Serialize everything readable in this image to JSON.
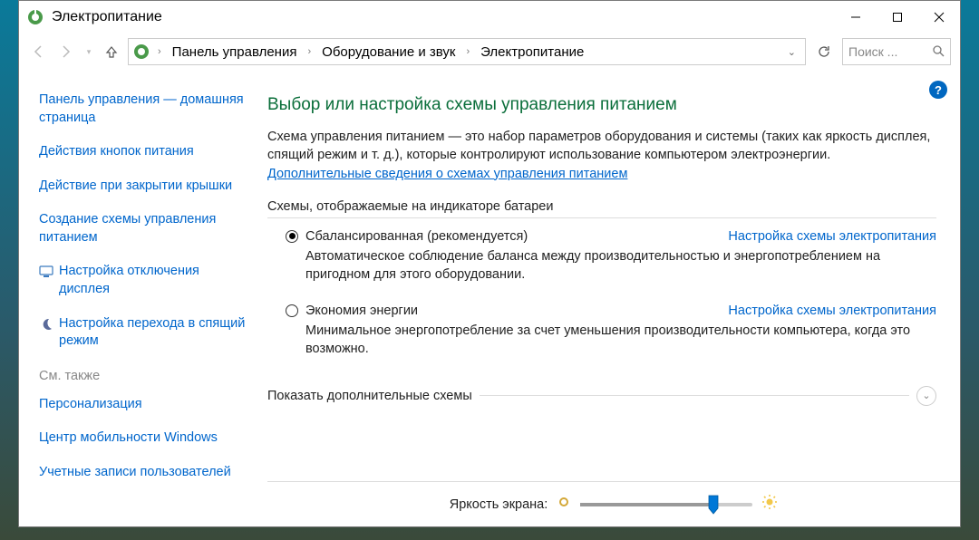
{
  "window": {
    "title": "Электропитание"
  },
  "breadcrumb": {
    "items": [
      "Панель управления",
      "Оборудование и звук",
      "Электропитание"
    ]
  },
  "search": {
    "placeholder": "Поиск ..."
  },
  "sidebar": {
    "home": "Панель управления — домашняя страница",
    "links": [
      "Действия кнопок питания",
      "Действие при закрытии крышки",
      "Создание схемы управления питанием",
      "Настройка отключения дисплея",
      "Настройка перехода в спящий режим"
    ],
    "see_also_hdr": "См. также",
    "see_also": [
      "Персонализация",
      "Центр мобильности Windows",
      "Учетные записи пользователей"
    ]
  },
  "content": {
    "heading": "Выбор или настройка схемы управления питанием",
    "description": "Схема управления питанием — это набор параметров оборудования и системы (таких как яркость дисплея, спящий режим и т. д.), которые контролируют использование компьютером электроэнергии.",
    "more_info": "Дополнительные сведения о схемах управления питанием",
    "section_hdr": "Схемы, отображаемые на индикаторе батареи",
    "plans": [
      {
        "name": "Сбалансированная (рекомендуется)",
        "selected": true,
        "desc": "Автоматическое соблюдение баланса между производительностью и энергопотреблением на пригодном для этого оборудовании.",
        "config": "Настройка схемы электропитания"
      },
      {
        "name": "Экономия энергии",
        "selected": false,
        "desc": "Минимальное энергопотребление за счет уменьшения производительности компьютера, когда это возможно.",
        "config": "Настройка схемы электропитания"
      }
    ],
    "expand_label": "Показать дополнительные схемы",
    "brightness_label": "Яркость экрана:",
    "brightness_percent": 75
  }
}
